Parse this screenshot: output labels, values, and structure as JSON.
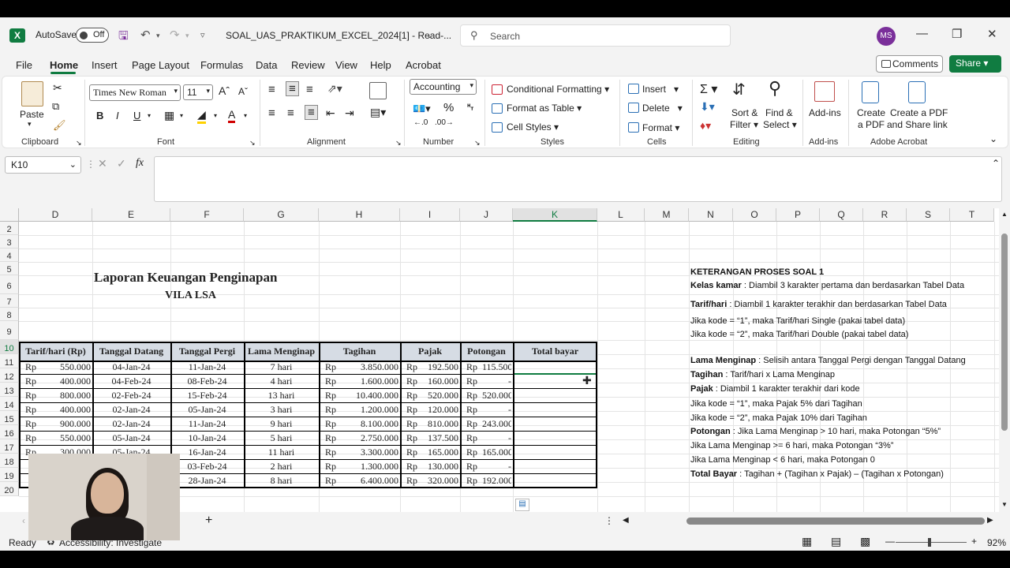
{
  "titlebar": {
    "autosave_label": "AutoSave",
    "autosave_state": "Off",
    "doc_title": "SOAL_UAS_PRAKTIKUM_EXCEL_2024[1]  -  Read-...",
    "search_placeholder": "Search",
    "avatar_initials": "MS"
  },
  "tabs": [
    "File",
    "Home",
    "Insert",
    "Page Layout",
    "Formulas",
    "Data",
    "Review",
    "View",
    "Help",
    "Acrobat"
  ],
  "active_tab": "Home",
  "actions": {
    "comments": "Comments",
    "share": "Share"
  },
  "ribbon": {
    "clipboard": {
      "paste": "Paste",
      "label": "Clipboard"
    },
    "font": {
      "name": "Times New Roman",
      "size": "11",
      "label": "Font"
    },
    "alignment": {
      "label": "Alignment"
    },
    "number": {
      "format": "Accounting",
      "label": "Number"
    },
    "styles": {
      "conditional": "Conditional Formatting",
      "format_table": "Format as Table",
      "cell_styles": "Cell Styles",
      "label": "Styles"
    },
    "cells": {
      "insert": "Insert",
      "delete": "Delete",
      "format": "Format",
      "label": "Cells"
    },
    "editing": {
      "sort1": "Sort &",
      "sort2": "Filter",
      "find1": "Find &",
      "find2": "Select",
      "label": "Editing"
    },
    "addins": {
      "btn": "Add-ins",
      "label": "Add-ins"
    },
    "acrobat": {
      "pdf1": "Create",
      "pdf2": "a PDF",
      "share1": "Create a PDF",
      "share2": "and Share link",
      "label": "Adobe Acrobat"
    }
  },
  "formula_bar": {
    "name_box": "K10",
    "fx": "fx",
    "value": ""
  },
  "columns": [
    "D",
    "E",
    "F",
    "G",
    "H",
    "I",
    "J",
    "K",
    "L",
    "M",
    "N",
    "O",
    "P",
    "Q",
    "R",
    "S",
    "T"
  ],
  "selected_column": "K",
  "rows": [
    "2",
    "3",
    "4",
    "5",
    "6",
    "7",
    "8",
    "9",
    "10",
    "11",
    "12",
    "13",
    "14",
    "15",
    "16",
    "17",
    "18",
    "19",
    "20"
  ],
  "selected_row": "10",
  "sheet": {
    "title": "Laporan  Keuangan Penginapan",
    "subtitle": "VILA LSA",
    "headers": [
      "Tarif/hari (Rp)",
      "Tanggal Datang",
      "Tanggal Pergi",
      "Lama Menginap",
      "Tagihan",
      "Pajak",
      "Potongan",
      "Total bayar"
    ],
    "data": [
      {
        "tarif": "550.000",
        "datang": "04-Jan-24",
        "pergi": "11-Jan-24",
        "lama": "7 hari",
        "tagihan": "3.850.000",
        "pajak": "192.500",
        "potongan": "115.500"
      },
      {
        "tarif": "400.000",
        "datang": "04-Feb-24",
        "pergi": "08-Feb-24",
        "lama": "4 hari",
        "tagihan": "1.600.000",
        "pajak": "160.000",
        "potongan": "-"
      },
      {
        "tarif": "800.000",
        "datang": "02-Feb-24",
        "pergi": "15-Feb-24",
        "lama": "13 hari",
        "tagihan": "10.400.000",
        "pajak": "520.000",
        "potongan": "520.000"
      },
      {
        "tarif": "400.000",
        "datang": "02-Jan-24",
        "pergi": "05-Jan-24",
        "lama": "3 hari",
        "tagihan": "1.200.000",
        "pajak": "120.000",
        "potongan": "-"
      },
      {
        "tarif": "900.000",
        "datang": "02-Jan-24",
        "pergi": "11-Jan-24",
        "lama": "9 hari",
        "tagihan": "8.100.000",
        "pajak": "810.000",
        "potongan": "243.000"
      },
      {
        "tarif": "550.000",
        "datang": "05-Jan-24",
        "pergi": "10-Jan-24",
        "lama": "5 hari",
        "tagihan": "2.750.000",
        "pajak": "137.500",
        "potongan": "-"
      },
      {
        "tarif": "300.000",
        "datang": "05-Jan-24",
        "pergi": "16-Jan-24",
        "lama": "11 hari",
        "tagihan": "3.300.000",
        "pajak": "165.000",
        "potongan": "165.000"
      },
      {
        "tarif": "",
        "datang": "",
        "pergi": "03-Feb-24",
        "lama": "2 hari",
        "tagihan": "1.300.000",
        "pajak": "130.000",
        "potongan": "-"
      },
      {
        "tarif": "",
        "datang": "",
        "pergi": "28-Jan-24",
        "lama": "8 hari",
        "tagihan": "6.400.000",
        "pajak": "320.000",
        "potongan": "192.000"
      }
    ],
    "currency": "Rp"
  },
  "notes": [
    {
      "bold": "KETERANGAN PROSES SOAL 1",
      "text": ""
    },
    {
      "bold": "Kelas kamar",
      "text": " : Diambil 3 karakter pertama dan berdasarkan Tabel Data"
    },
    {
      "bold": "Tarif/hari",
      "text": " : Diambil 1 karakter terakhir dan berdasarkan Tabel Data"
    },
    {
      "bold": "",
      "text": "Jika kode = “1”, maka Tarif/hari Single (pakai tabel data)"
    },
    {
      "bold": "",
      "text": "Jika kode = “2”, maka Tarif/hari Double (pakai tabel data)"
    },
    {
      "bold": "Lama Menginap",
      "text": " : Selisih antara Tanggal Pergi dengan Tanggal Datang"
    },
    {
      "bold": "Tagihan",
      "text": " : Tarif/hari x Lama Menginap"
    },
    {
      "bold": "Pajak",
      "text": " : Diambil 1 karakter terakhir dari kode"
    },
    {
      "bold": "",
      "text": "Jika kode = “1”, maka Pajak 5% dari Tagihan"
    },
    {
      "bold": "",
      "text": "Jika kode = “2”, maka Pajak 10% dari Tagihan"
    },
    {
      "bold": "Potongan",
      "text": " : Jika Lama Menginap > 10 hari, maka Potongan “5%”"
    },
    {
      "bold": "",
      "text": "Jika Lama Menginap >= 6 hari, maka Potongan “3%”"
    },
    {
      "bold": "",
      "text": "Jika Lama Menginap < 6 hari, maka Potongan 0"
    },
    {
      "bold": "Total Bayar",
      "text": " : Tagihan + (Tagihan x Pajak) – (Tagihan x Potongan)"
    }
  ],
  "status": {
    "ready": "Ready",
    "accessibility": "Accessibility: Investigate",
    "zoom": "92%"
  }
}
